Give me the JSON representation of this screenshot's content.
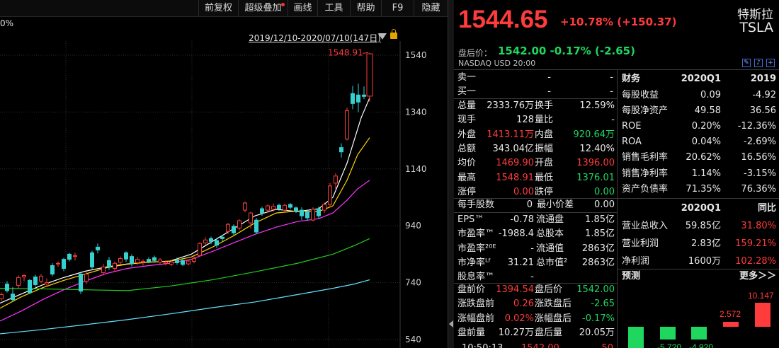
{
  "toolbar": {
    "buttons": [
      "前复权",
      "超级叠加",
      "画线",
      "工具",
      "帮助",
      "F9",
      "隐藏"
    ]
  },
  "chart": {
    "pct_label": "0%",
    "date_range": "2019/12/10-2020/07/10(147日)",
    "high_label": "1548.91",
    "y_ticks": [
      "1540",
      "1340",
      "1140",
      "940",
      "740",
      "540"
    ]
  },
  "chart_data": {
    "type": "candlestick",
    "ylim": [
      540,
      1560
    ],
    "y_ticks": [
      1540,
      1340,
      1140,
      940,
      740,
      540
    ],
    "candles": [
      {
        "o": 683,
        "c": 698,
        "h": 705,
        "l": 676,
        "up": true
      },
      {
        "o": 712,
        "c": 735,
        "h": 745,
        "l": 705,
        "up": false
      },
      {
        "o": 700,
        "c": 680,
        "h": 724,
        "l": 675,
        "up": false
      },
      {
        "o": 730,
        "c": 758,
        "h": 765,
        "l": 720,
        "up": true
      },
      {
        "o": 760,
        "c": 765,
        "h": 770,
        "l": 745,
        "up": true
      },
      {
        "o": 705,
        "c": 748,
        "h": 753,
        "l": 700,
        "up": false
      },
      {
        "o": 733,
        "c": 760,
        "h": 768,
        "l": 726,
        "up": false
      },
      {
        "o": 745,
        "c": 763,
        "h": 770,
        "l": 738,
        "up": true
      },
      {
        "o": 740,
        "c": 735,
        "h": 755,
        "l": 728,
        "up": true
      },
      {
        "o": 770,
        "c": 800,
        "h": 808,
        "l": 763,
        "up": false
      },
      {
        "o": 808,
        "c": 807,
        "h": 815,
        "l": 795,
        "up": true
      },
      {
        "o": 790,
        "c": 822,
        "h": 827,
        "l": 780,
        "up": false
      },
      {
        "o": 822,
        "c": 840,
        "h": 845,
        "l": 815,
        "up": false
      },
      {
        "o": 832,
        "c": 835,
        "h": 845,
        "l": 818,
        "up": true
      },
      {
        "o": 710,
        "c": 770,
        "h": 775,
        "l": 700,
        "up": false
      },
      {
        "o": 745,
        "c": 770,
        "h": 780,
        "l": 735,
        "up": true
      },
      {
        "o": 795,
        "c": 845,
        "h": 852,
        "l": 785,
        "up": false
      },
      {
        "o": 855,
        "c": 865,
        "h": 878,
        "l": 843,
        "up": false
      },
      {
        "o": 775,
        "c": 795,
        "h": 805,
        "l": 765,
        "up": true
      },
      {
        "o": 795,
        "c": 818,
        "h": 830,
        "l": 785,
        "up": false
      },
      {
        "o": 790,
        "c": 808,
        "h": 815,
        "l": 780,
        "up": true
      },
      {
        "o": 812,
        "c": 825,
        "h": 832,
        "l": 805,
        "up": true
      },
      {
        "o": 823,
        "c": 845,
        "h": 850,
        "l": 812,
        "up": false
      },
      {
        "o": 807,
        "c": 832,
        "h": 840,
        "l": 797,
        "up": false
      },
      {
        "o": 810,
        "c": 822,
        "h": 830,
        "l": 802,
        "up": true
      },
      {
        "o": 812,
        "c": 815,
        "h": 822,
        "l": 800,
        "up": true
      },
      {
        "o": 815,
        "c": 822,
        "h": 830,
        "l": 808,
        "up": false
      },
      {
        "o": 818,
        "c": 828,
        "h": 835,
        "l": 810,
        "up": false
      },
      {
        "o": 812,
        "c": 820,
        "h": 827,
        "l": 805,
        "up": true
      },
      {
        "o": 808,
        "c": 812,
        "h": 817,
        "l": 800,
        "up": true
      },
      {
        "o": 805,
        "c": 812,
        "h": 820,
        "l": 798,
        "up": true
      },
      {
        "o": 810,
        "c": 818,
        "h": 828,
        "l": 803,
        "up": false
      },
      {
        "o": 804,
        "c": 818,
        "h": 825,
        "l": 798,
        "up": false
      },
      {
        "o": 806,
        "c": 816,
        "h": 822,
        "l": 800,
        "up": true
      },
      {
        "o": 815,
        "c": 825,
        "h": 832,
        "l": 808,
        "up": true
      },
      {
        "o": 835,
        "c": 878,
        "h": 882,
        "l": 830,
        "up": true
      },
      {
        "o": 880,
        "c": 890,
        "h": 900,
        "l": 873,
        "up": true
      },
      {
        "o": 885,
        "c": 895,
        "h": 902,
        "l": 875,
        "up": false
      },
      {
        "o": 872,
        "c": 888,
        "h": 897,
        "l": 862,
        "up": false
      },
      {
        "o": 895,
        "c": 900,
        "h": 908,
        "l": 885,
        "up": false
      },
      {
        "o": 920,
        "c": 945,
        "h": 950,
        "l": 912,
        "up": true
      },
      {
        "o": 915,
        "c": 938,
        "h": 945,
        "l": 905,
        "up": false
      },
      {
        "o": 932,
        "c": 958,
        "h": 963,
        "l": 925,
        "up": true
      },
      {
        "o": 995,
        "c": 1020,
        "h": 1025,
        "l": 987,
        "up": true
      },
      {
        "o": 950,
        "c": 985,
        "h": 990,
        "l": 930,
        "up": true
      },
      {
        "o": 918,
        "c": 960,
        "h": 968,
        "l": 910,
        "up": false
      },
      {
        "o": 985,
        "c": 1000,
        "h": 1007,
        "l": 975,
        "up": false
      },
      {
        "o": 995,
        "c": 1010,
        "h": 1015,
        "l": 985,
        "up": true
      },
      {
        "o": 998,
        "c": 1008,
        "h": 1018,
        "l": 990,
        "up": true
      },
      {
        "o": 1000,
        "c": 1012,
        "h": 1018,
        "l": 992,
        "up": false
      },
      {
        "o": 995,
        "c": 1012,
        "h": 1018,
        "l": 988,
        "up": true
      },
      {
        "o": 1005,
        "c": 1015,
        "h": 1020,
        "l": 998,
        "up": false
      },
      {
        "o": 992,
        "c": 1003,
        "h": 1008,
        "l": 985,
        "up": false
      },
      {
        "o": 975,
        "c": 995,
        "h": 1005,
        "l": 960,
        "up": false
      },
      {
        "o": 968,
        "c": 990,
        "h": 995,
        "l": 958,
        "up": false
      },
      {
        "o": 960,
        "c": 998,
        "h": 1005,
        "l": 955,
        "up": true
      },
      {
        "o": 975,
        "c": 1000,
        "h": 1008,
        "l": 965,
        "up": false
      },
      {
        "o": 995,
        "c": 1015,
        "h": 1022,
        "l": 985,
        "up": true
      },
      {
        "o": 1015,
        "c": 1080,
        "h": 1090,
        "l": 1005,
        "up": true
      },
      {
        "o": 1090,
        "c": 1115,
        "h": 1125,
        "l": 1070,
        "up": true
      },
      {
        "o": 1200,
        "c": 1215,
        "h": 1230,
        "l": 1180,
        "up": false
      },
      {
        "o": 1245,
        "c": 1345,
        "h": 1355,
        "l": 1240,
        "up": true
      },
      {
        "o": 1370,
        "c": 1405,
        "h": 1432,
        "l": 1350,
        "up": false
      },
      {
        "o": 1400,
        "c": 1375,
        "h": 1440,
        "l": 1340,
        "up": false
      },
      {
        "o": 1395,
        "c": 1400,
        "h": 1430,
        "l": 1385,
        "up": false
      },
      {
        "o": 1396,
        "c": 1544.65,
        "h": 1548.91,
        "l": 1376.01,
        "up": true
      }
    ],
    "ma": [
      {
        "color": "#ffffff",
        "points": [
          [
            0,
            668
          ],
          [
            30,
            700
          ],
          [
            60,
            732
          ],
          [
            90,
            758
          ],
          [
            120,
            780
          ],
          [
            150,
            795
          ],
          [
            180,
            806
          ],
          [
            210,
            812
          ],
          [
            240,
            816
          ],
          [
            270,
            840
          ],
          [
            300,
            885
          ],
          [
            330,
            930
          ],
          [
            360,
            975
          ],
          [
            390,
            998
          ],
          [
            420,
            990
          ],
          [
            450,
            1000
          ],
          [
            470,
            1040
          ],
          [
            490,
            1160
          ],
          [
            510,
            1320
          ],
          [
            522,
            1390
          ]
        ]
      },
      {
        "color": "#ffd700",
        "points": [
          [
            0,
            650
          ],
          [
            30,
            690
          ],
          [
            60,
            722
          ],
          [
            90,
            748
          ],
          [
            120,
            770
          ],
          [
            150,
            792
          ],
          [
            180,
            805
          ],
          [
            210,
            812
          ],
          [
            240,
            815
          ],
          [
            270,
            830
          ],
          [
            300,
            865
          ],
          [
            330,
            905
          ],
          [
            360,
            950
          ],
          [
            390,
            985
          ],
          [
            420,
            992
          ],
          [
            450,
            990
          ],
          [
            470,
            1010
          ],
          [
            490,
            1100
          ],
          [
            505,
            1190
          ],
          [
            522,
            1250
          ]
        ]
      },
      {
        "color": "#ff33ff",
        "points": [
          [
            0,
            605
          ],
          [
            30,
            640
          ],
          [
            60,
            680
          ],
          [
            90,
            715
          ],
          [
            120,
            745
          ],
          [
            150,
            772
          ],
          [
            180,
            790
          ],
          [
            210,
            800
          ],
          [
            240,
            808
          ],
          [
            270,
            822
          ],
          [
            300,
            850
          ],
          [
            330,
            880
          ],
          [
            360,
            910
          ],
          [
            390,
            935
          ],
          [
            420,
            955
          ],
          [
            450,
            965
          ],
          [
            470,
            985
          ],
          [
            490,
            1030
          ],
          [
            505,
            1070
          ],
          [
            522,
            1100
          ]
        ]
      },
      {
        "color": "#22cc22",
        "points": [
          [
            0,
            720
          ],
          [
            60,
            718
          ],
          [
            120,
            715
          ],
          [
            180,
            712
          ],
          [
            240,
            728
          ],
          [
            300,
            750
          ],
          [
            360,
            778
          ],
          [
            420,
            808
          ],
          [
            470,
            840
          ],
          [
            500,
            870
          ],
          [
            522,
            895
          ]
        ]
      },
      {
        "color": "#66e0ff",
        "points": [
          [
            0,
            560
          ],
          [
            60,
            575
          ],
          [
            120,
            592
          ],
          [
            180,
            610
          ],
          [
            240,
            630
          ],
          [
            300,
            652
          ],
          [
            360,
            672
          ],
          [
            420,
            698
          ],
          [
            470,
            720
          ],
          [
            500,
            735
          ],
          [
            522,
            750
          ]
        ]
      }
    ]
  },
  "quote": {
    "price": "1544.65",
    "change": "+10.78% (+150.37)",
    "name": "特斯拉",
    "code": "TSLA",
    "after_label": "盘后价：",
    "after_value": "1542.00 -0.17% (-2.65)",
    "exchange": "NASDAQ  USD  20:00"
  },
  "orderbook": [
    {
      "label": "卖一",
      "a": "-",
      "b": "-"
    },
    {
      "label": "买一",
      "a": "-",
      "b": "-"
    }
  ],
  "stats": [
    {
      "l1": "总量",
      "v1": "2333.76万",
      "c1": "wht",
      "l2": "换手",
      "v2": "12.59%",
      "c2": "wht"
    },
    {
      "l1": "现手",
      "v1": "128",
      "c1": "wht",
      "l2": "量比",
      "v2": "-",
      "c2": "wht"
    },
    {
      "l1": "外盘",
      "v1": "1413.11万",
      "c1": "red",
      "l2": "内盘",
      "v2": "920.64万",
      "c2": "green"
    },
    {
      "l1": "总额",
      "v1": "343.04亿",
      "c1": "wht",
      "l2": "振幅",
      "v2": "12.40%",
      "c2": "wht"
    },
    {
      "l1": "均价",
      "v1": "1469.90",
      "c1": "red",
      "l2": "开盘",
      "v2": "1396.00",
      "c2": "red"
    },
    {
      "l1": "最高",
      "v1": "1548.91",
      "c1": "red",
      "l2": "最低",
      "v2": "1376.01",
      "c2": "green"
    },
    {
      "l1": "涨停",
      "v1": "0.00",
      "c1": "red",
      "l2": "跌停",
      "v2": "0.00",
      "c2": "green"
    }
  ],
  "lot": {
    "l1": "每手股数",
    "v1": "0",
    "l2": "最小价差",
    "v2": "0.00"
  },
  "valuation": [
    {
      "l1": "EPS™",
      "v1": "-0.78",
      "l2": "流通盘",
      "v2": "1.85亿"
    },
    {
      "l1": "市盈率™",
      "v1": "-1988.4",
      "l2": "总股本",
      "v2": "1.85亿"
    },
    {
      "l1": "市盈率²⁰ᴱ",
      "v1": "-",
      "l2": "流通值",
      "v2": "2863亿"
    },
    {
      "l1": "市净率ᴸᶠ",
      "v1": "31.21",
      "l2": "总市值²",
      "v2": "2863亿"
    },
    {
      "l1": "股息率™",
      "v1": "-",
      "l2": "",
      "v2": ""
    }
  ],
  "pre_post": [
    {
      "l1": "盘前价",
      "v1": "1394.54",
      "c1": "red",
      "l2": "盘后价",
      "v2": "1542.00",
      "c2": "green"
    },
    {
      "l1": "涨跌盘前",
      "v1": "0.26",
      "c1": "red",
      "l2": "涨跌盘后",
      "v2": "-2.65",
      "c2": "green"
    },
    {
      "l1": "涨幅盘前",
      "v1": "0.02%",
      "c1": "red",
      "l2": "涨幅盘后",
      "v2": "-0.17%",
      "c2": "green"
    },
    {
      "l1": "盘前量",
      "v1": "10.27万",
      "c1": "wht",
      "l2": "盘后量",
      "v2": "20.05万",
      "c2": "wht"
    }
  ],
  "finance": {
    "header": [
      "财务",
      "2020Q1",
      "2019"
    ],
    "rows": [
      {
        "l": "每股收益",
        "a": "0.09",
        "b": "-4.92"
      },
      {
        "l": "每股净资产",
        "a": "49.58",
        "b": "36.56"
      },
      {
        "l": "ROE",
        "a": "0.20%",
        "b": "-12.36%"
      },
      {
        "l": "ROA",
        "a": "0.04%",
        "b": "-2.69%"
      },
      {
        "l": "销售毛利率",
        "a": "20.62%",
        "b": "16.56%"
      },
      {
        "l": "销售净利率",
        "a": "1.14%",
        "b": "-3.15%"
      },
      {
        "l": "资产负债率",
        "a": "71.35%",
        "b": "76.36%"
      }
    ],
    "header2": [
      "",
      "2020Q1",
      "同比"
    ],
    "rows2": [
      {
        "l": "营业总收入",
        "a": "59.85亿",
        "b": "31.80%"
      },
      {
        "l": "营业利润",
        "a": "2.83亿",
        "b": "159.21%"
      },
      {
        "l": "净利润",
        "a": "1600万",
        "b": "102.28%"
      }
    ]
  },
  "forecast": {
    "title": "预测",
    "more": "更多＞＞",
    "bar_labels": [
      "-5.720",
      "-4.920",
      "2.572",
      "10.147"
    ]
  },
  "bottom": {
    "time": "10:50:13",
    "price": "1542.00",
    "vol": "50"
  }
}
